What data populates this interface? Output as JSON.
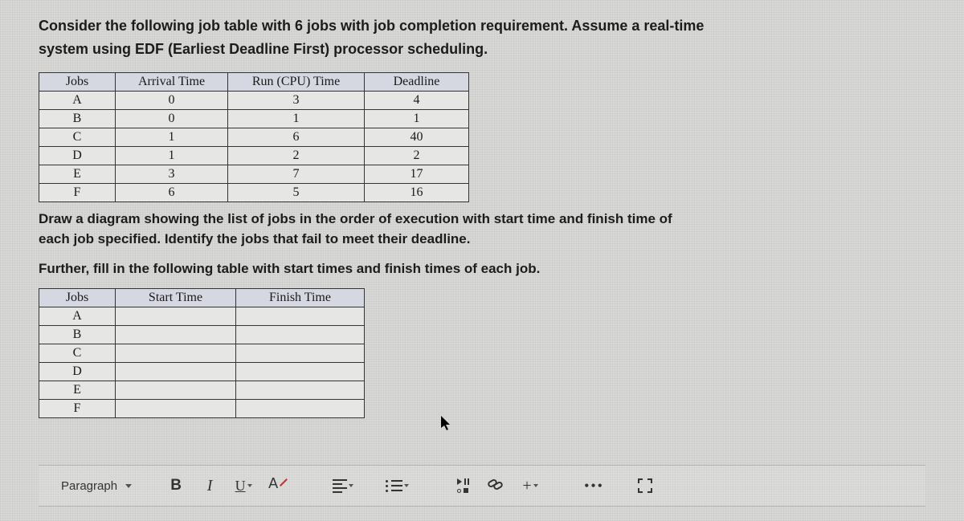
{
  "intro_line1": "Consider the following job table with 6 jobs with job completion requirement. Assume a real-time",
  "intro_line2": "system using EDF (Earliest Deadline First) processor scheduling.",
  "job_table": {
    "headers": [
      "Jobs",
      "Arrival Time",
      "Run (CPU) Time",
      "Deadline"
    ],
    "rows": [
      {
        "job": "A",
        "arrival": "0",
        "run": "3",
        "deadline": "4"
      },
      {
        "job": "B",
        "arrival": "0",
        "run": "1",
        "deadline": "1"
      },
      {
        "job": "C",
        "arrival": "1",
        "run": "6",
        "deadline": "40"
      },
      {
        "job": "D",
        "arrival": "1",
        "run": "2",
        "deadline": "2"
      },
      {
        "job": "E",
        "arrival": "3",
        "run": "7",
        "deadline": "17"
      },
      {
        "job": "F",
        "arrival": "6",
        "run": "5",
        "deadline": "16"
      }
    ]
  },
  "mid_line1": "Draw a diagram showing the list of jobs in the order of execution with start time and finish time of",
  "mid_line2": "each job specified. Identify the jobs that fail to meet their deadline.",
  "mid_line3": "Further, fill in the following table with start times and finish times of each job.",
  "result_table": {
    "headers": [
      "Jobs",
      "Start Time",
      "Finish Time"
    ],
    "rows": [
      {
        "job": "A",
        "start": "",
        "finish": ""
      },
      {
        "job": "B",
        "start": "",
        "finish": ""
      },
      {
        "job": "C",
        "start": "",
        "finish": ""
      },
      {
        "job": "D",
        "start": "",
        "finish": ""
      },
      {
        "job": "E",
        "start": "",
        "finish": ""
      },
      {
        "job": "F",
        "start": "",
        "finish": ""
      }
    ]
  },
  "toolbar": {
    "format": "Paragraph",
    "bold": "B",
    "italic": "I",
    "underline": "U",
    "clear": "A",
    "plus": "+",
    "more": "•••"
  }
}
